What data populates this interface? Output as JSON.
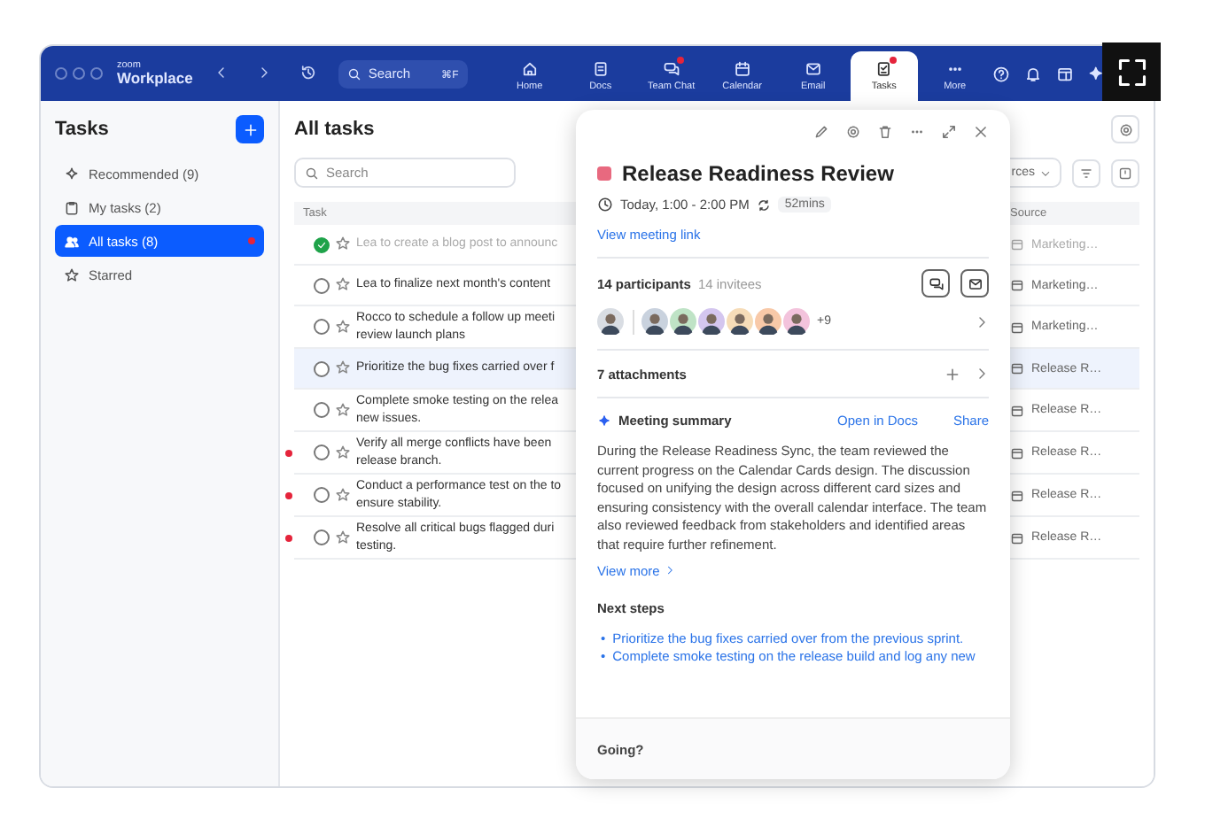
{
  "window": {
    "brand_top": "zoom",
    "brand": "Workplace",
    "search": {
      "placeholder": "Search",
      "shortcut": "⌘F"
    }
  },
  "nav_tabs": [
    {
      "label": "Home",
      "selected": false,
      "badge": false
    },
    {
      "label": "Docs",
      "selected": false,
      "badge": false
    },
    {
      "label": "Team Chat",
      "selected": false,
      "badge": true
    },
    {
      "label": "Calendar",
      "selected": false,
      "badge": false
    },
    {
      "label": "Email",
      "selected": false,
      "badge": false
    },
    {
      "label": "Tasks",
      "selected": true,
      "badge": true
    },
    {
      "label": "More",
      "selected": false,
      "badge": false
    }
  ],
  "sidebar": {
    "title": "Tasks",
    "items": [
      {
        "label": "Recommended (9)",
        "selected": false,
        "badge": false
      },
      {
        "label": "My tasks (2)",
        "selected": false,
        "badge": false
      },
      {
        "label": "All tasks (8)",
        "selected": true,
        "badge": true
      },
      {
        "label": "Starred",
        "selected": false,
        "badge": false
      }
    ]
  },
  "main": {
    "title": "All tasks",
    "search": {
      "placeholder": "Search"
    },
    "filter_label": "rces",
    "columns": [
      "Task",
      "Source"
    ],
    "rows": [
      {
        "task": "Lea to create a blog post to announc",
        "source": "Marketing…",
        "done": true,
        "selected": false,
        "flagged": false
      },
      {
        "task": "Lea to finalize next month's content",
        "source": "Marketing…",
        "done": false,
        "selected": false,
        "flagged": false
      },
      {
        "task": "Rocco to schedule a follow up meeti review launch plans",
        "source": "Marketing…",
        "done": false,
        "selected": false,
        "flagged": false
      },
      {
        "task": "Prioritize the bug fixes carried over f",
        "source": "Release R…",
        "done": false,
        "selected": true,
        "flagged": false
      },
      {
        "task": "Complete smoke testing on the relea new issues.",
        "source": "Release R…",
        "done": false,
        "selected": false,
        "flagged": false
      },
      {
        "task": "Verify all merge conflicts have been release branch.",
        "source": "Release R…",
        "done": false,
        "selected": false,
        "flagged": true
      },
      {
        "task": "Conduct a performance test on the to ensure stability.",
        "source": "Release R…",
        "done": false,
        "selected": false,
        "flagged": true
      },
      {
        "task": "Resolve all critical bugs flagged duri testing.",
        "source": "Release R…",
        "done": false,
        "selected": false,
        "flagged": true
      }
    ]
  },
  "event": {
    "title": "Release Readiness Review",
    "time": "Today, 1:00 - 2:00 PM",
    "duration": "52mins",
    "link": "View meeting link",
    "participants": "14 participants",
    "invitees": "14 invitees",
    "more_count": "+9",
    "attachments": "7 attachments",
    "summary_title": "Meeting summary",
    "open_docs": "Open in Docs",
    "share": "Share",
    "summary": "During the Release Readiness Sync, the team reviewed the current progress on the Calendar Cards design. The discussion focused on unifying the design across different card sizes and ensuring consistency with the overall calendar interface. The team also reviewed feedback from stakeholders and identified areas that require further refinement.",
    "view_more": "View more",
    "next_steps_title": "Next steps",
    "next_steps": [
      {
        "marker": "•",
        "text": "Prioritize the bug fixes carried over from the previous sprint."
      },
      {
        "marker": "•",
        "text": "Complete smoke testing on the release build and log any new"
      }
    ],
    "rsvp_label": "Going?"
  }
}
